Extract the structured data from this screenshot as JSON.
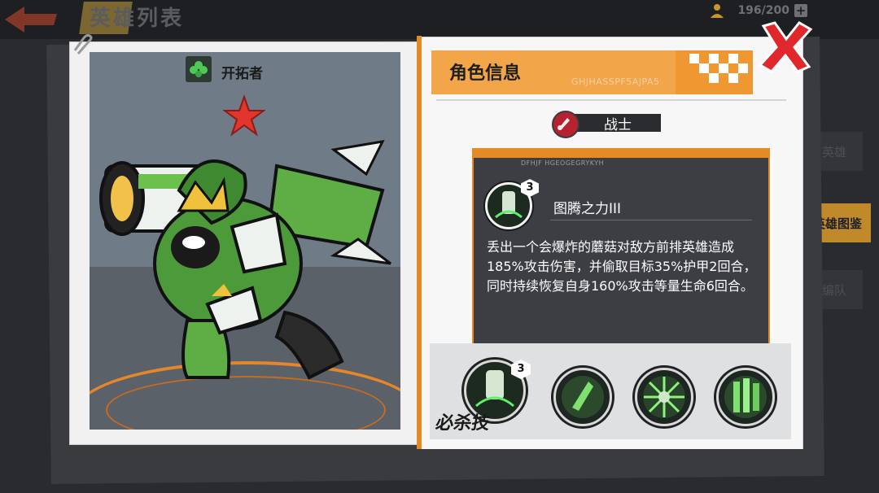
{
  "background": {
    "title": "英雄列表",
    "hero_count": "196/200",
    "counter_plus": "+",
    "side_tabs": [
      "英雄",
      "英雄图鉴",
      "编队"
    ]
  },
  "hero": {
    "class_label": "开拓者",
    "class_icon": "clover-icon",
    "rarity_icon": "red-star-icon"
  },
  "info": {
    "title": "角色信息",
    "code": "GHJHASSPF5AJPA5",
    "role": "战士",
    "role_icon": "role-rocket-icon"
  },
  "skill": {
    "header_code": "DFHJF HGEOGEGRYKYH",
    "level": "3",
    "name": "图腾之力III",
    "description": "丢出一个会爆炸的蘑菇对敌方前排英雄造成185%攻击伤害，并偷取目标35%护甲2回合，同时持续恢复自身160%攻击等量生命6回合。"
  },
  "skill_bar": {
    "ultimate_label": "必杀技",
    "ultimate_level": "3",
    "slots": [
      "ultimate-skill",
      "skill-2",
      "skill-3",
      "skill-4"
    ]
  },
  "colors": {
    "accent": "#e58b26",
    "panel_dark": "#3d3e43",
    "close_red": "#e0282c",
    "hero_green": "#5fae45"
  }
}
